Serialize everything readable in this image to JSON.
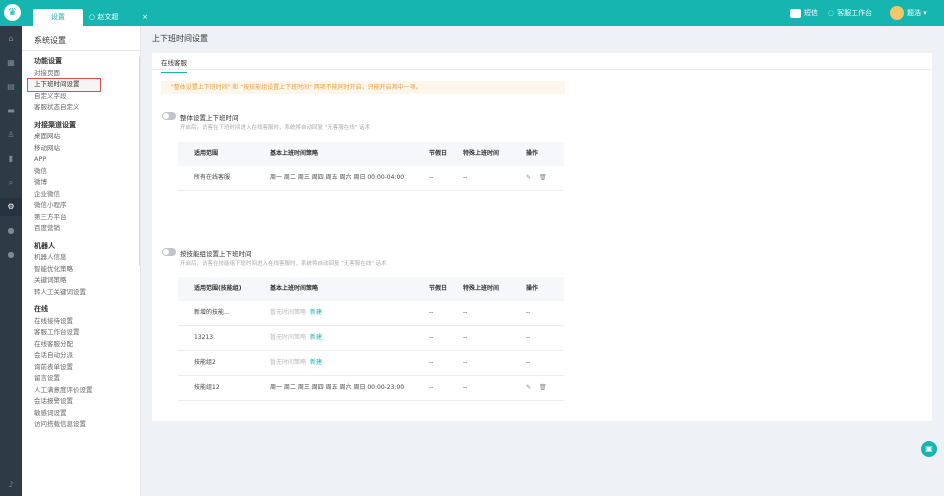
{
  "tabs": {
    "active_label": "设置",
    "second_label": "赵文超",
    "second_icon": "○",
    "close_glyph": "×"
  },
  "topbar_right": {
    "sms_label": "短信",
    "workbench_label": "客服工作台",
    "user_label": "题浩"
  },
  "sidebar": {
    "title": "系统设置",
    "groups": [
      {
        "title": "功能设置",
        "items": [
          "对接页面",
          "上下班时间设置",
          "自定义字段",
          "客服状态自定义"
        ]
      },
      {
        "title": "对接渠道设置",
        "items": [
          "桌面网站",
          "移动网站",
          "APP",
          "微信",
          "微博",
          "企业微信",
          "微信小程序",
          "第三方平台",
          "百度营销"
        ]
      },
      {
        "title": "机器人",
        "items": [
          "机器人信息",
          "智能优化策略",
          "关键词策略",
          "转人工关键词设置"
        ]
      },
      {
        "title": "在线",
        "items": [
          "在线接待设置",
          "客服工作台设置",
          "在线客服分配",
          "会话自动分派",
          "询前表单设置",
          "留言设置",
          "人工满意度评价设置",
          "会话报警设置",
          "敏感词设置",
          "访问搭载信息设置"
        ]
      }
    ]
  },
  "main": {
    "page_title": "上下班时间设置",
    "card_tab": "在线客服",
    "notice": "\"整体设置上下班时间\" 和 \"按技能组设置上下班时间\" 两项不能同时开启，只能开启其中一项。",
    "section1": {
      "title": "整体设置上下班时间",
      "desc": "开启后，访客在下班时间进入在线客服时，系统将自动回复 \"无客服在线\" 话术",
      "headers": [
        "适用范围",
        "基本上班时间策略",
        "节假日",
        "特殊上班时间",
        "操作"
      ],
      "rows": [
        {
          "scope": "所有在线客服",
          "policy": "周一 周二 周三 周四 周五 周六 周日 00:00-04:00",
          "holiday": "--",
          "special": "--"
        }
      ]
    },
    "section2": {
      "title": "按技能组设置上下班时间",
      "desc": "开启后，访客在技能组下班时间进入在线客服时，系统将自动回复 \"无客服在线\" 话术",
      "headers": [
        "适用范围(技能组)",
        "基本上班时间策略",
        "节假日",
        "特殊上班时间",
        "操作"
      ],
      "rows": [
        {
          "scope": "新增的技能...",
          "policy": "暂无时间策略",
          "new": "新建",
          "holiday": "--",
          "special": "--",
          "op": "--"
        },
        {
          "scope": "13213",
          "policy": "暂无时间策略",
          "new": "新建",
          "holiday": "--",
          "special": "--",
          "op": "--"
        },
        {
          "scope": "技能组2",
          "policy": "暂无时间策略",
          "new": "新建",
          "holiday": "--",
          "special": "--",
          "op": "--"
        },
        {
          "scope": "技能组12",
          "policy": "周一 周二 周三 周四 周五 周六 周日 00:00-23:00",
          "holiday": "--",
          "special": "--"
        }
      ]
    },
    "icons": {
      "edit": "✎",
      "delete": "🗑"
    }
  },
  "colors": {
    "brand": "#16b5b0",
    "sidebar_dark": "#2f3a47",
    "notice_text": "#e6a23c",
    "selected_outline": "#e24b4b"
  }
}
